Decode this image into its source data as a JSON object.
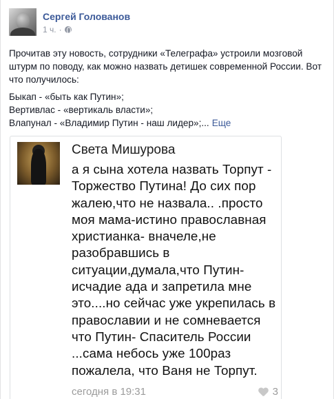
{
  "post": {
    "author": "Сергей Голованов",
    "time": "1 ч.",
    "separator": "·",
    "intro": "Прочитав эту новость, сотрудники «Телеграфа» устроили мозговой штурм по поводу, как можно назвать детишек современной России. Вот что получилось:",
    "lines": [
      "Быкап - «быть как Путин»;",
      "Вертивлас - «вертикаль власти»;",
      "Влапунал - «Владимир Путин - наш лидер»;..."
    ],
    "more_label": "Еще"
  },
  "shared": {
    "name": "Света Мишурова",
    "text": "а я сына хотела назвать Торпут - Торжество Путина! До сих пор жалею,что не назвала.. .просто моя мама-истино православная христианка- вначеле,не разобравшись в ситуации,думала,что Путин- исчадие ада и запретила мне это....но сейчас уже укрепилась в православии и не сомневается что Путин- Спаситель России ...сама небось уже 100раз пожалела, что Ваня не Торпут.",
    "timestamp": "сегодня в 19:31",
    "likes": "3"
  },
  "icons": {
    "privacy": "globe-icon",
    "like": "heart-icon"
  },
  "colors": {
    "link": "#3b5998",
    "meta": "#9197a3",
    "text": "#141823"
  }
}
